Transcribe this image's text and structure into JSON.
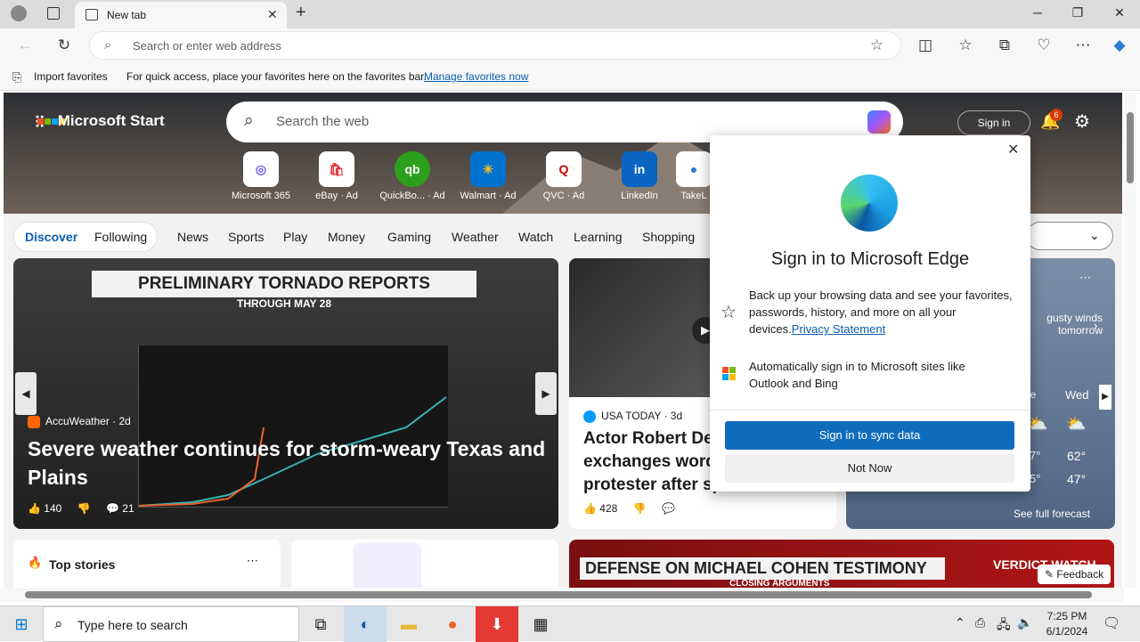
{
  "browser": {
    "tab_title": "New tab",
    "address_placeholder": "Search or enter web address",
    "favorites_bar": {
      "import_label": "Import favorites",
      "hint": "For quick access, place your favorites here on the favorites bar.",
      "manage_link": "Manage favorites now"
    }
  },
  "start": {
    "brand": "Microsoft Start",
    "search_placeholder": "Search the web",
    "sign_in": "Sign in",
    "notification_count": "6",
    "quick_links": [
      {
        "label": "Microsoft 365",
        "glyph": "◎"
      },
      {
        "label": "eBay · Ad",
        "glyph": "🛍"
      },
      {
        "label": "QuickBo... · Ad",
        "glyph": "qb"
      },
      {
        "label": "Walmart · Ad",
        "glyph": "✳"
      },
      {
        "label": "QVC · Ad",
        "glyph": "Q"
      },
      {
        "label": "LinkedIn",
        "glyph": "in"
      },
      {
        "label": "TakeL",
        "glyph": "●"
      }
    ],
    "tabs": {
      "discover": "Discover",
      "following": "Following",
      "items": [
        "News",
        "Sports",
        "Play",
        "Money",
        "Gaming",
        "Weather",
        "Watch",
        "Learning",
        "Shopping"
      ]
    },
    "main_card": {
      "banner": "PRELIMINARY TORNADO REPORTS",
      "banner_sub": "THROUGH MAY 28",
      "source": "AccuWeather · 2d",
      "headline": "Severe weather continues for storm-weary Texas and Plains",
      "likes": "140",
      "comments": "21"
    },
    "card2": {
      "source": "USA TODAY · 3d",
      "headline": "Actor Robert De Niro exchanges words with protester after speech",
      "likes": "428"
    },
    "weather": {
      "alert": "gusty winds tomorrow",
      "day": "Wed",
      "high": "62°",
      "low": "47°",
      "partial_high": "7°",
      "partial_low": "5°",
      "partial_day": "ne",
      "forecast_link": "See full forecast"
    },
    "top_stories": "Top stories",
    "cohen_banner": "DEFENSE ON MICHAEL COHEN TESTIMONY",
    "cohen_sub": "CLOSING ARGUMENTS",
    "cohen_right": "VERDICT WATCH",
    "feedback": "Feedback"
  },
  "popup": {
    "title": "Sign in to Microsoft Edge",
    "row1_text": "Back up your browsing data and see your favorites, passwords, history, and more on all your devices.",
    "privacy_link": "Privacy Statement",
    "row2_text": "Automatically sign in to Microsoft sites like Outlook and Bing",
    "primary_button": "Sign in to sync data",
    "secondary_button": "Not Now"
  },
  "taskbar": {
    "search_placeholder": "Type here to search",
    "time": "7:25 PM",
    "date": "6/1/2024"
  }
}
